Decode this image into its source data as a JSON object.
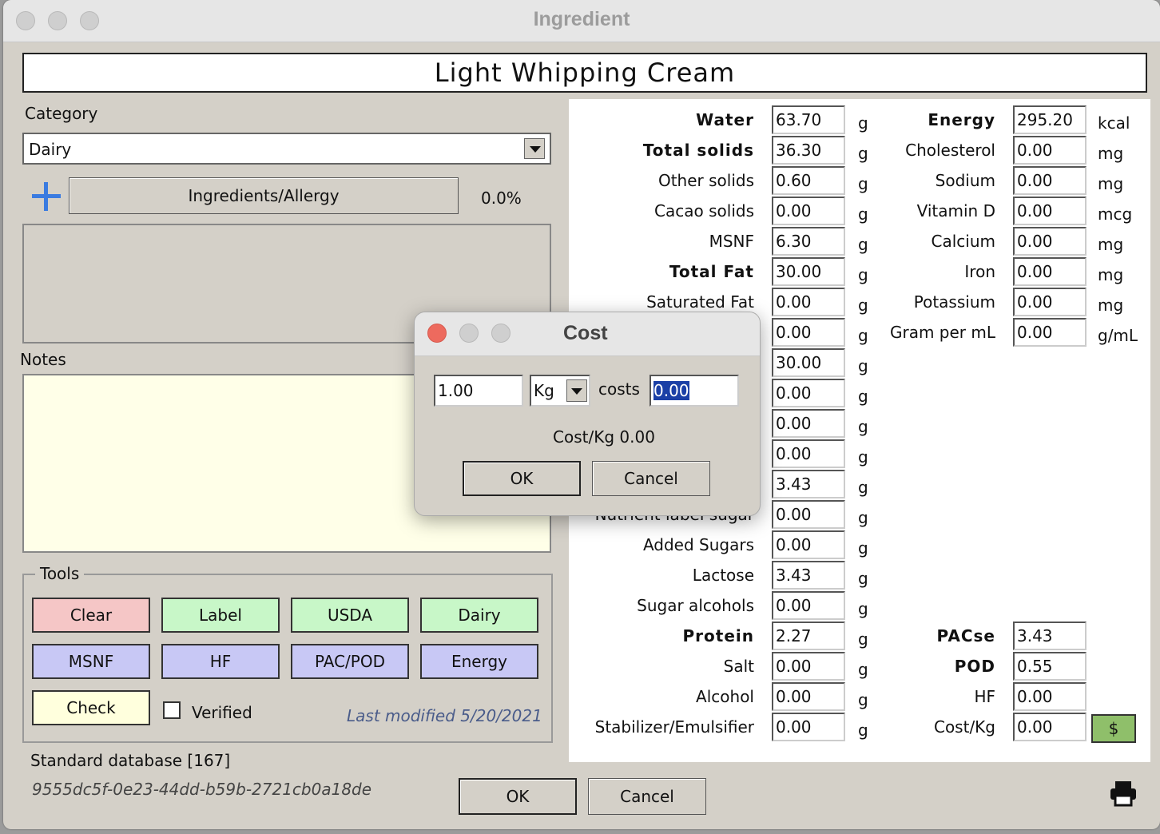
{
  "window": {
    "title": "Ingredient"
  },
  "ingredient_name": "Light Whipping Cream",
  "category": {
    "label": "Category",
    "value": "Dairy"
  },
  "ingredients_allergy": {
    "label": "Ingredients/Allergy",
    "percent": "0.0%"
  },
  "notes": {
    "label": "Notes"
  },
  "tools": {
    "label": "Tools",
    "buttons": [
      "Clear",
      "Label",
      "USDA",
      "Dairy",
      "MSNF",
      "HF",
      "PAC/POD",
      "Energy",
      "Check"
    ],
    "verified_label": "Verified",
    "last_modified": "Last modified 5/20/2021"
  },
  "database": "Standard database [167]",
  "uuid": "9555dc5f-0e23-44dd-b59b-2721cb0a18de",
  "footer": {
    "ok": "OK",
    "cancel": "Cancel"
  },
  "composition": [
    {
      "label": "Water",
      "value": "63.70",
      "unit": "g"
    },
    {
      "label": "Total solids",
      "value": "36.30",
      "unit": "g"
    },
    {
      "label": "Other solids",
      "value": "0.60",
      "unit": "g"
    },
    {
      "label": "Cacao solids",
      "value": "0.00",
      "unit": "g"
    },
    {
      "label": "MSNF",
      "value": "6.30",
      "unit": "g"
    },
    {
      "label": "Total Fat",
      "value": "30.00",
      "unit": "g"
    },
    {
      "label": "Saturated Fat",
      "value": "0.00",
      "unit": "g"
    },
    {
      "label": "",
      "value": "0.00",
      "unit": "g"
    },
    {
      "label": "",
      "value": "30.00",
      "unit": "g"
    },
    {
      "label": "",
      "value": "0.00",
      "unit": "g"
    },
    {
      "label": "",
      "value": "0.00",
      "unit": "g"
    },
    {
      "label": "",
      "value": "0.00",
      "unit": "g"
    },
    {
      "label": "",
      "value": "3.43",
      "unit": "g"
    },
    {
      "label": "Nutrient label sugar",
      "value": "0.00",
      "unit": "g"
    },
    {
      "label": "Added Sugars",
      "value": "0.00",
      "unit": "g"
    },
    {
      "label": "Lactose",
      "value": "3.43",
      "unit": "g"
    },
    {
      "label": "Sugar alcohols",
      "value": "0.00",
      "unit": "g"
    },
    {
      "label": "Protein",
      "value": "2.27",
      "unit": "g"
    },
    {
      "label": "Salt",
      "value": "0.00",
      "unit": "g"
    },
    {
      "label": "Alcohol",
      "value": "0.00",
      "unit": "g"
    },
    {
      "label": "Stabilizer/Emulsifier",
      "value": "0.00",
      "unit": "g"
    }
  ],
  "nutrients": [
    {
      "label": "Energy",
      "value": "295.20",
      "unit": "kcal"
    },
    {
      "label": "Cholesterol",
      "value": "0.00",
      "unit": "mg"
    },
    {
      "label": "Sodium",
      "value": "0.00",
      "unit": "mg"
    },
    {
      "label": "Vitamin D",
      "value": "0.00",
      "unit": "mcg"
    },
    {
      "label": "Calcium",
      "value": "0.00",
      "unit": "mg"
    },
    {
      "label": "Iron",
      "value": "0.00",
      "unit": "mg"
    },
    {
      "label": "Potassium",
      "value": "0.00",
      "unit": "mg"
    },
    {
      "label": "Gram per mL",
      "value": "0.00",
      "unit": "g/mL"
    }
  ],
  "pac": [
    {
      "label": "PACse",
      "value": "3.43"
    },
    {
      "label": "POD",
      "value": "0.55"
    },
    {
      "label": "HF",
      "value": "0.00"
    },
    {
      "label": "Cost/Kg",
      "value": "0.00"
    }
  ],
  "cost_button": "$",
  "cost_dialog": {
    "title": "Cost",
    "quantity": "1.00",
    "unit": "Kg",
    "costs_label": "costs",
    "cost_value": "0.00",
    "summary": "Cost/Kg 0.00",
    "ok": "OK",
    "cancel": "Cancel"
  },
  "colors": {
    "close_red": "#ed6a5e",
    "cost_green": "#8fbf6a",
    "notes_bg": "#ffffe8",
    "accent_blue": "#3a7be0"
  }
}
